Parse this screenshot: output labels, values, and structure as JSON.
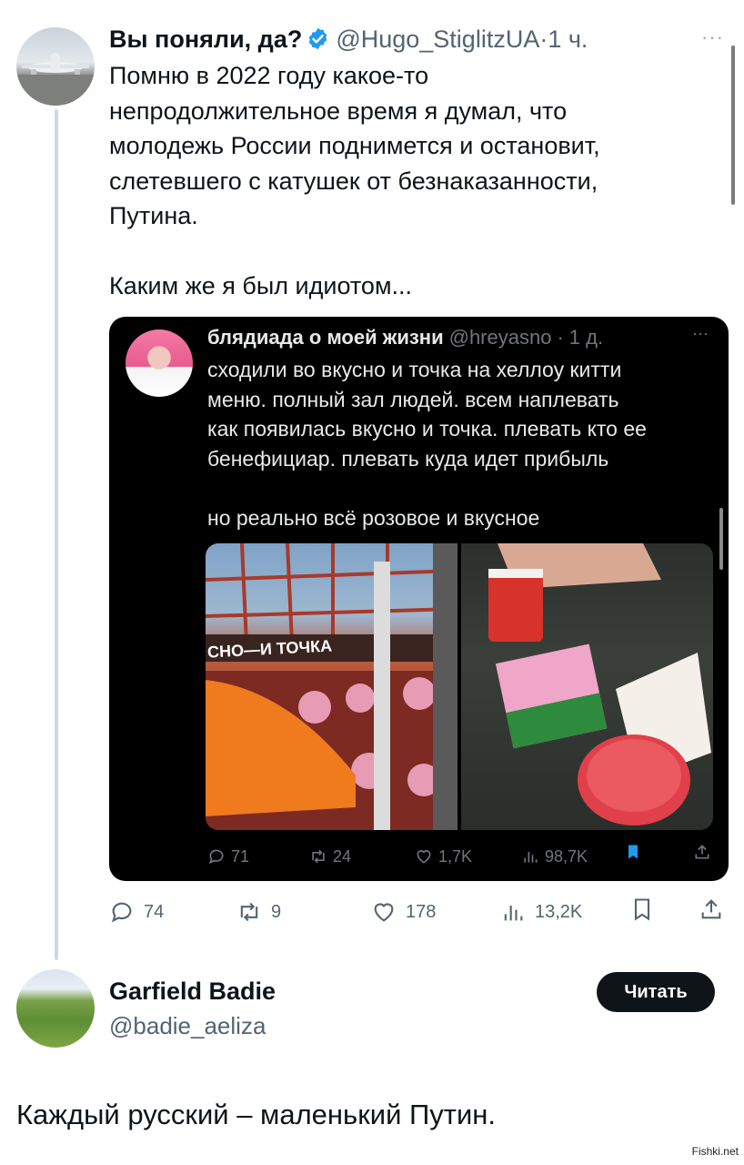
{
  "tweet": {
    "author_name": "Вы поняли, да?",
    "author_handle": "@Hugo_StiglitzUA",
    "separator": "·",
    "time": "1 ч.",
    "more": "···",
    "text": "Помню в 2022 году какое-то\nнепродолжительное время я думал, что\nмолодежь России поднимется и остановит,\nслетевшего с катушек от безнаказанности,\nПутина.\n\nКаким же я был идиотом...",
    "stats": {
      "replies": "74",
      "retweets": "9",
      "likes": "178",
      "views": "13,2K"
    }
  },
  "quoted": {
    "author_name": "блядиада о моей жизни",
    "author_handle": "@hreyasno",
    "separator": "·",
    "time": "1 д.",
    "more": "···",
    "text": "сходили во вкусно и точка на хеллоу китти\nменю. полный зал людей. всем наплевать\nкак появилась вкусно и точка. плевать кто ее\nбенефициар. плевать куда идет прибыль\n\nно реально всё розовое и вкусное",
    "sign_text": "СНО—И ТОЧКА",
    "stats": {
      "replies": "71",
      "retweets": "24",
      "likes": "1,7K",
      "views": "98,7K"
    }
  },
  "profile": {
    "name": "Garfield Badie",
    "handle": "@badie_aeliza",
    "follow_label": "Читать"
  },
  "caption": "Каждый русский – маленький Путин.",
  "watermark": "Fishki.net",
  "colors": {
    "accent": "#1d9bf0",
    "text": "#0f1419",
    "muted": "#536471",
    "follow_bg": "#0f1419"
  }
}
